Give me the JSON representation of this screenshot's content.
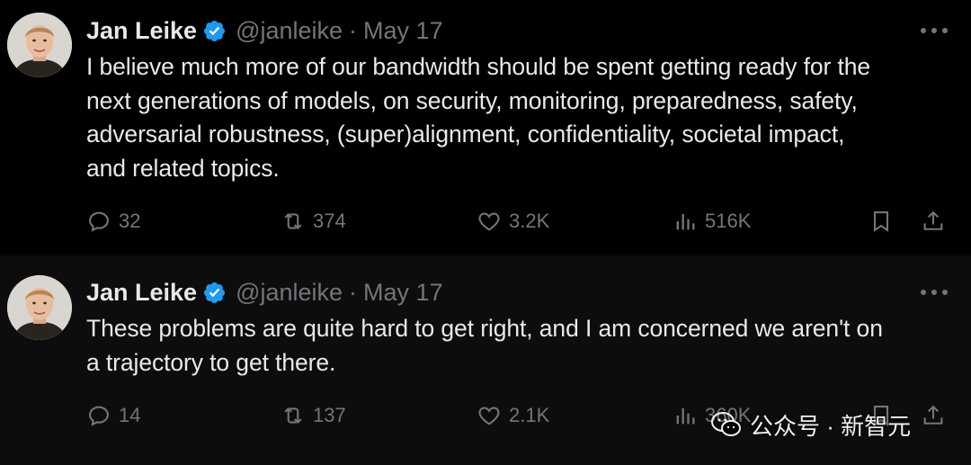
{
  "tweets": [
    {
      "name": "Jan Leike",
      "handle": "@janleike",
      "separator": "·",
      "date": "May 17",
      "lines": [
        "I believe much more of our bandwidth should be spent getting ready for the",
        "next generations of models, on security, monitoring, preparedness, safety,",
        "adversarial robustness, (super)alignment, confidentiality, societal impact,",
        "and related topics."
      ],
      "replies": "32",
      "reposts": "374",
      "likes": "3.2K",
      "views": "516K"
    },
    {
      "name": "Jan Leike",
      "handle": "@janleike",
      "separator": "·",
      "date": "May 17",
      "lines": [
        "These problems are quite hard to get right, and I am concerned we aren't on",
        "a trajectory to get there."
      ],
      "replies": "14",
      "reposts": "137",
      "likes": "2.1K",
      "views": "360K"
    }
  ],
  "watermark": {
    "text": "公众号 · 新智元",
    "icon": "wechat-icon"
  },
  "colors": {
    "background": "#000000",
    "text": "#e7e9ea",
    "muted": "#71767b",
    "verified": "#1d9bf0"
  }
}
